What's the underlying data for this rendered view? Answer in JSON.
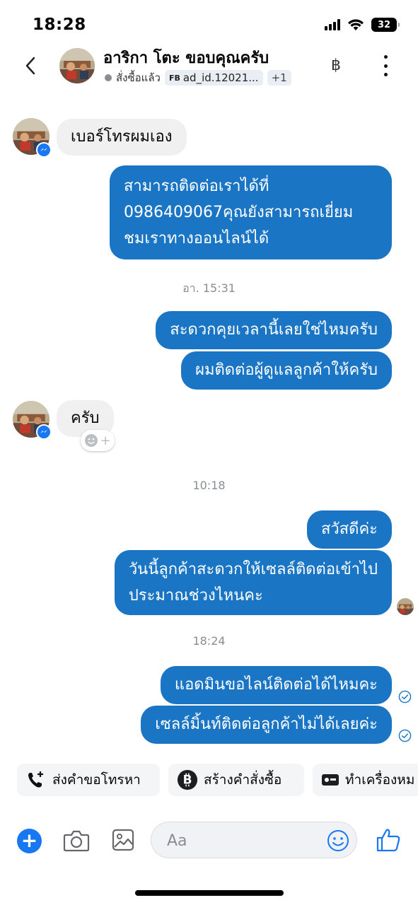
{
  "status_bar": {
    "time": "18:28",
    "battery": "32"
  },
  "header": {
    "title": "อาริกา โตะ ขอบคุณครับ",
    "status_label": "สั่งซื้อแล้ว",
    "ad_tag_prefix": "FB",
    "ad_tag": "ad_id.12021...",
    "extra_tags": "+1",
    "baht_symbol": "฿"
  },
  "messages": {
    "in_1": "เบอร์โทรผมเอง",
    "out_1": [
      "สามารถติดต่อเราได้ที่",
      "0986409067คุณยังสามารถเยี่ยม",
      "ชมเราทางออนไลน์ได้"
    ],
    "time_1": "อา. 15:31",
    "out_2": "สะดวกคุยเวลานี้เลยใช่ไหมครับ",
    "out_3": "ผมติดต่อผู้ดูแลลูกค้าให้ครับ",
    "in_2": "ครับ",
    "time_2": "10:18",
    "out_4": "สวัสดีค่ะ",
    "out_5": [
      "วันนี้ลูกค้าสะดวกให้เซลล์ติดต่อเข้าไป",
      "ประมาณช่วงไหนคะ"
    ],
    "time_3": "18:24",
    "out_6": "แอดมินขอไลน์ติดต่อได้ไหมคะ",
    "out_7": "เซลล์มิ้นท์ติดต่อลูกค้าไม่ได้เลยค่ะ"
  },
  "quick_actions": [
    {
      "label": "ส่งคำขอโทรหา",
      "icon": "phone-plus-icon"
    },
    {
      "label": "สร้างคำสั่งซื้อ",
      "icon": "bitcoin-icon"
    },
    {
      "label": "ทำเครื่องหม",
      "icon": "card-icon"
    }
  ],
  "composer": {
    "placeholder": "Aa"
  },
  "colors": {
    "outgoing": "#1a75c4",
    "incoming": "#f0f0f0",
    "accent": "#1877f2"
  }
}
